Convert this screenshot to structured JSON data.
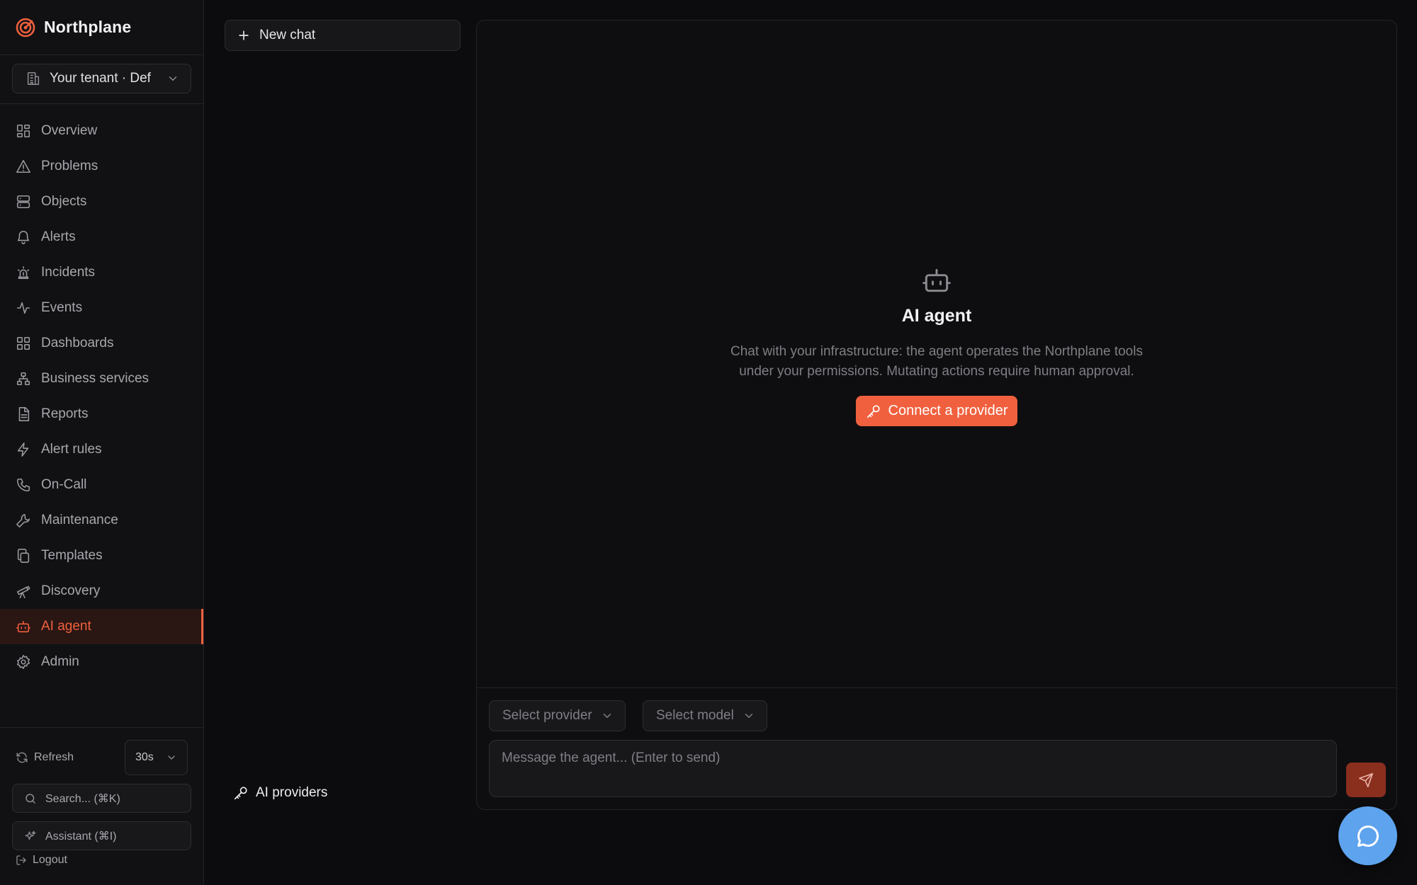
{
  "brand": {
    "name": "Northplane",
    "accent": "#f0603e"
  },
  "tenant": {
    "label": "Your tenant · Def"
  },
  "nav": {
    "items": [
      {
        "label": "Overview",
        "icon": "grid-icon"
      },
      {
        "label": "Problems",
        "icon": "warning-icon"
      },
      {
        "label": "Objects",
        "icon": "server-icon"
      },
      {
        "label": "Alerts",
        "icon": "bell-icon"
      },
      {
        "label": "Incidents",
        "icon": "siren-icon"
      },
      {
        "label": "Events",
        "icon": "activity-icon"
      },
      {
        "label": "Dashboards",
        "icon": "dashboard-icon"
      },
      {
        "label": "Business services",
        "icon": "network-icon"
      },
      {
        "label": "Reports",
        "icon": "report-icon"
      },
      {
        "label": "Alert rules",
        "icon": "lightning-icon"
      },
      {
        "label": "On-Call",
        "icon": "phone-icon"
      },
      {
        "label": "Maintenance",
        "icon": "wrench-icon"
      },
      {
        "label": "Templates",
        "icon": "copy-icon"
      },
      {
        "label": "Discovery",
        "icon": "telescope-icon"
      },
      {
        "label": "AI agent",
        "icon": "robot-icon",
        "active": true
      },
      {
        "label": "Admin",
        "icon": "gear-icon"
      }
    ]
  },
  "footer": {
    "refresh_label": "Refresh",
    "interval": "30s",
    "search_label": "Search... (⌘K)",
    "assistant_label": "Assistant (⌘I)",
    "logout_label": "Logout"
  },
  "chatlist": {
    "new_chat_label": "New chat",
    "providers_label": "AI providers"
  },
  "agent": {
    "title": "AI agent",
    "description": "Chat with your infrastructure: the agent operates the Northplane tools under your permissions. Mutating actions require human approval.",
    "connect_label": "Connect a provider"
  },
  "composer": {
    "provider_placeholder": "Select provider",
    "model_placeholder": "Select model",
    "message_placeholder": "Message the agent... (Enter to send)"
  }
}
